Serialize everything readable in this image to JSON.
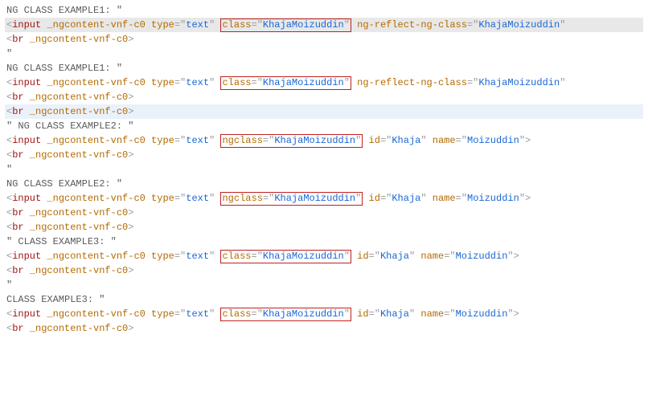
{
  "colors": {
    "punctuation": "#999999",
    "tag": "#a31515",
    "attr": "#b36a00",
    "value": "#1a66d6",
    "text": "#5a5a5a",
    "highlight_border": "#c02020",
    "selected_bg": "#e8e8e8",
    "hovered_bg": "#eaf1fb"
  },
  "lines": {
    "l1_text": "NG CLASS EXAMPLE1: \"",
    "l4_text": "\"",
    "l5_text": "NG CLASS EXAMPLE1: \"",
    "l9_text": "\" NG CLASS EXAMPLE2: \"",
    "l12_text": "\"",
    "l13_text": "NG CLASS EXAMPLE2: \"",
    "l17_text": "\" CLASS EXAMPLE3: \"",
    "l20_text": "\"",
    "l21_text": "CLASS EXAMPLE3: \""
  },
  "tokens": {
    "input": "input",
    "br": "br",
    "ngcontent_attr": "_ngcontent-vnf-c0",
    "type_attr": "type",
    "type_val": "text",
    "class_attr": "class",
    "ngclass_attr": "ngclass",
    "class_val": "KhajaMoizuddin",
    "ngreflect_attr": "ng-reflect-ng-class",
    "ngreflect_val": "KhajaMoizuddin",
    "id_attr": "id",
    "id_val": "Khaja",
    "name_attr": "name",
    "name_val": "Moizuddin"
  }
}
